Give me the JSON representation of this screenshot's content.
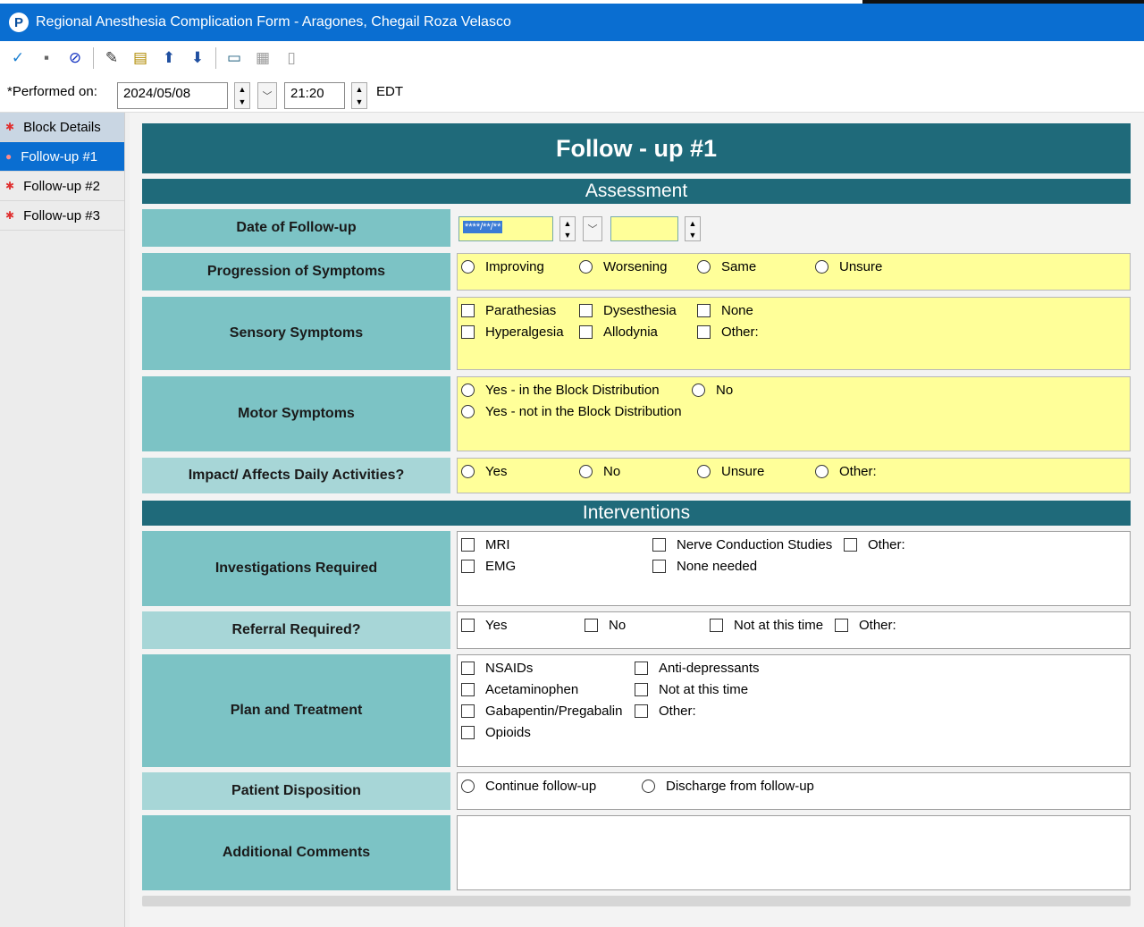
{
  "window": {
    "title": "Regional Anesthesia Complication Form - Aragones, Chegail Roza Velasco",
    "app_icon_letter": "P"
  },
  "toolbar": {
    "buttons": [
      {
        "name": "sign-icon",
        "glyph": "✓",
        "color": "#1a7fd1"
      },
      {
        "name": "save-icon",
        "glyph": "▪",
        "color": "#666666"
      },
      {
        "name": "cancel-icon",
        "glyph": "⊘",
        "color": "#1030c0"
      },
      {
        "name": "pen-icon",
        "glyph": "✎",
        "color": "#333333"
      },
      {
        "name": "note-icon",
        "glyph": "▤",
        "color": "#b08a00"
      },
      {
        "name": "up-arrow-icon",
        "glyph": "⬆",
        "color": "#1f4fa0"
      },
      {
        "name": "down-arrow-icon",
        "glyph": "⬇",
        "color": "#1f4fa0"
      },
      {
        "name": "display-icon",
        "glyph": "▭",
        "color": "#1f5f7f"
      },
      {
        "name": "calculator-icon",
        "glyph": "▦",
        "color": "#9a9a9a"
      },
      {
        "name": "document-icon",
        "glyph": "▯",
        "color": "#9a9a9a"
      }
    ]
  },
  "performed": {
    "label": "*Performed on:",
    "date": "2024/05/08",
    "time": "21:20",
    "timezone": "EDT"
  },
  "nav": {
    "items": [
      {
        "label": "Block Details"
      },
      {
        "label": "Follow-up #1"
      },
      {
        "label": "Follow-up #2"
      },
      {
        "label": "Follow-up #3"
      }
    ]
  },
  "form": {
    "title": "Follow - up #1",
    "assessment_title": "Assessment",
    "interventions_title": "Interventions",
    "date_followup": {
      "label": "Date of Follow-up",
      "date_placeholder": "****/**/**"
    },
    "progression": {
      "label": "Progression of Symptoms",
      "options": [
        "Improving",
        "Worsening",
        "Same",
        "Unsure"
      ]
    },
    "sensory": {
      "label": "Sensory Symptoms",
      "options": [
        "Parathesias",
        "Dysesthesia",
        "None",
        "Hyperalgesia",
        "Allodynia",
        "Other:"
      ]
    },
    "motor": {
      "label": "Motor Symptoms",
      "options": [
        "Yes - in the Block Distribution",
        "No",
        "Yes - not in the Block Distribution"
      ]
    },
    "impact": {
      "label": "Impact/ Affects Daily Activities?",
      "options": [
        "Yes",
        "No",
        "Unsure",
        "Other:"
      ]
    },
    "investigations": {
      "label": "Investigations Required",
      "options": [
        "MRI",
        "Nerve Conduction Studies",
        "Other:",
        "EMG",
        "None needed"
      ]
    },
    "referral": {
      "label": "Referral Required?",
      "options": [
        "Yes",
        "No",
        "Not at this time",
        "Other:"
      ]
    },
    "plan": {
      "label": "Plan and Treatment",
      "options": [
        "NSAIDs",
        "Anti-depressants",
        "Acetaminophen",
        "Not at this time",
        "Gabapentin/Pregabalin",
        "Other:",
        "Opioids"
      ]
    },
    "disposition": {
      "label": "Patient Disposition",
      "options": [
        "Continue follow-up",
        "Discharge from follow-up"
      ]
    },
    "comments": {
      "label": "Additional Comments"
    }
  },
  "colors": {
    "titlebar": "#0a6ed1",
    "section": "#1f6a7a",
    "label_bg": "#7cc3c5",
    "label_bg_light": "#a7d6d7",
    "required_field": "#ffff99"
  }
}
